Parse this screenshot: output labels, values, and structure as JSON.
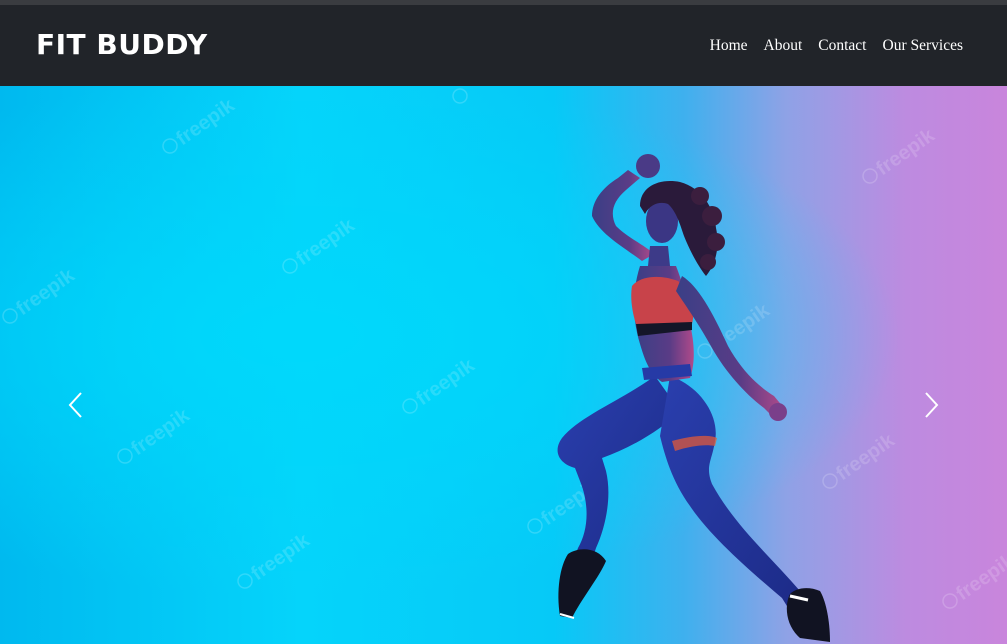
{
  "brand": {
    "name": "FIT BUDDY"
  },
  "nav": {
    "items": [
      {
        "label": "Home"
      },
      {
        "label": "About"
      },
      {
        "label": "Contact"
      },
      {
        "label": "Our Services"
      }
    ]
  },
  "hero": {
    "watermark_text": "freepik",
    "prev_icon": "chevron-left-icon",
    "next_icon": "chevron-right-icon"
  },
  "colors": {
    "navbar_bg": "#212429",
    "hero_cyan": "#05d4fb",
    "hero_pink": "#c985dc"
  }
}
